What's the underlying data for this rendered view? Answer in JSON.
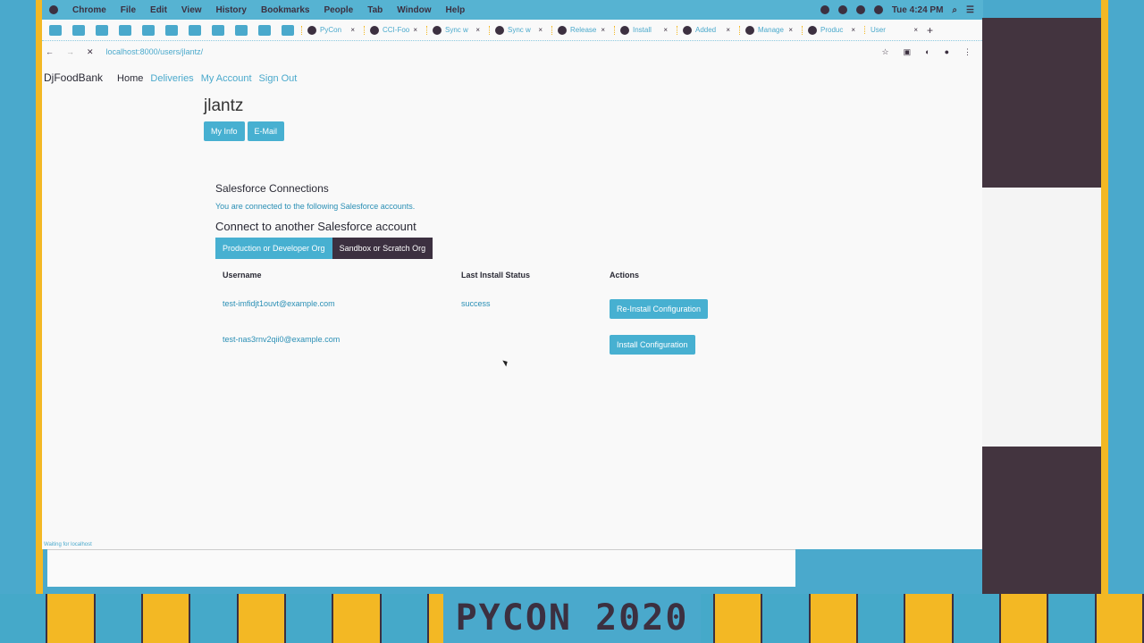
{
  "os_menu": {
    "items": [
      "Chrome",
      "File",
      "Edit",
      "View",
      "History",
      "Bookmarks",
      "People",
      "Tab",
      "Window",
      "Help"
    ],
    "clock": "Tue 4:24 PM"
  },
  "tabs": [
    "PyCon",
    "CCI-Foo",
    "Sync w",
    "Sync w",
    "Release",
    "Install",
    "Added",
    "Manage",
    "Produc",
    "User"
  ],
  "address": {
    "url": "localhost:8000/users/jlantz/"
  },
  "nav": {
    "brand": "DjFoodBank",
    "items": [
      "Home",
      "Deliveries",
      "My Account",
      "Sign Out"
    ]
  },
  "page": {
    "title": "jlantz",
    "buttons": [
      "My Info",
      "E-Mail"
    ]
  },
  "salesforce": {
    "heading": "Salesforce Connections",
    "intro": "You are connected to the following Salesforce accounts.",
    "connect_heading": "Connect to another Salesforce account",
    "connect_buttons": [
      "Production or Developer Org",
      "Sandbox or Scratch Org"
    ],
    "columns": [
      "Username",
      "Last Install Status",
      "Actions"
    ],
    "rows": [
      {
        "username": "test-imfidjt1ouvt@example.com",
        "status": "success",
        "action": "Re-Install Configuration"
      },
      {
        "username": "test-nas3rnv2qii0@example.com",
        "status": "",
        "action": "Install Configuration"
      }
    ]
  },
  "status_bar": "Waiting for localhost",
  "banner": {
    "text": "PYCON 2020"
  },
  "colors": {
    "accent": "#47b0d1",
    "dark": "#3c3040",
    "yellow": "#f3b824"
  }
}
